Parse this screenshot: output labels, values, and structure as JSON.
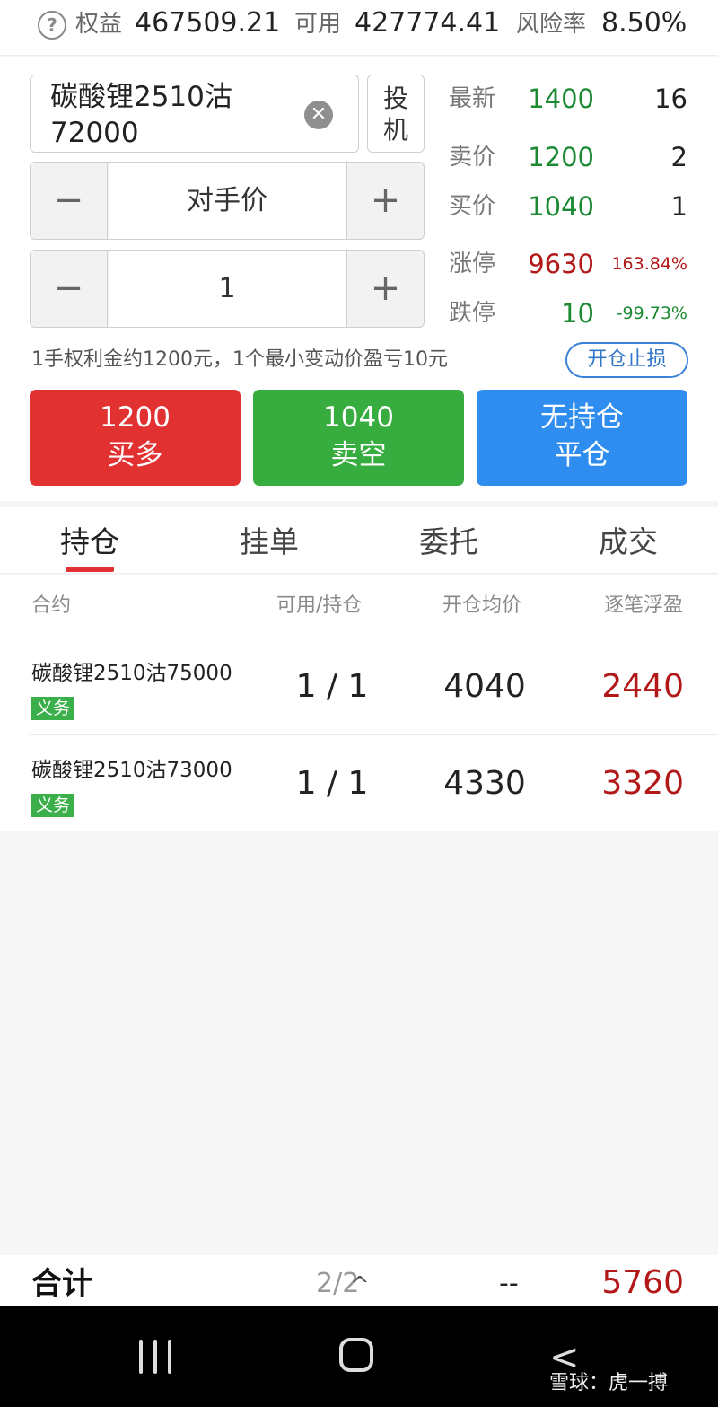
{
  "header": {
    "equity_label": "权益",
    "equity_value": "467509.21",
    "available_label": "可用",
    "available_value": "427774.41",
    "risk_label": "风险率",
    "risk_value": "8.50%"
  },
  "order": {
    "contract": "碳酸锂2510沽\n72000",
    "mode_label": "投\n机",
    "price_type": "对手价",
    "quantity": "1",
    "minus_symbol": "−",
    "plus_symbol": "+"
  },
  "quote": {
    "latest_label": "最新",
    "latest_price": "1400",
    "latest_volume": "16",
    "ask_label": "卖价",
    "ask_price": "1200",
    "ask_volume": "2",
    "bid_label": "买价",
    "bid_price": "1040",
    "bid_volume": "1",
    "limit_up_label": "涨停",
    "limit_up_price": "9630",
    "limit_up_pct": "163.84%",
    "limit_down_label": "跌停",
    "limit_down_price": "10",
    "limit_down_pct": "-99.73%"
  },
  "info": {
    "text": "1手权利金约1200元，1个最小变动价盈亏10元",
    "stoploss_label": "开仓止损"
  },
  "actions": {
    "buy_price": "1200",
    "buy_label": "买多",
    "sell_price": "1040",
    "sell_label": "卖空",
    "close_status": "无持仓",
    "close_label": "平仓"
  },
  "tabs": [
    "持仓",
    "挂单",
    "委托",
    "成交"
  ],
  "table": {
    "columns": [
      "合约",
      "可用/持仓",
      "开仓均价",
      "逐笔浮盈"
    ],
    "rows": [
      {
        "name": "碳酸锂2510沽75000",
        "badge": "义务",
        "qty": "1 / 1",
        "avg_price": "4040",
        "pnl": "2440"
      },
      {
        "name": "碳酸锂2510沽73000",
        "badge": "义务",
        "qty": "1 / 1",
        "avg_price": "4330",
        "pnl": "3320"
      }
    ]
  },
  "summary": {
    "label": "合计",
    "page": "2/2",
    "chevron": "^",
    "dash": "--",
    "total": "5760"
  },
  "nav": {
    "back_symbol": "<",
    "watermark": "雪球：虎一搏"
  },
  "colors": {
    "buy": "#e23131",
    "sell": "#37ad3f",
    "close": "#2f8def",
    "up": "#b21818",
    "down": "#1b8a32"
  }
}
